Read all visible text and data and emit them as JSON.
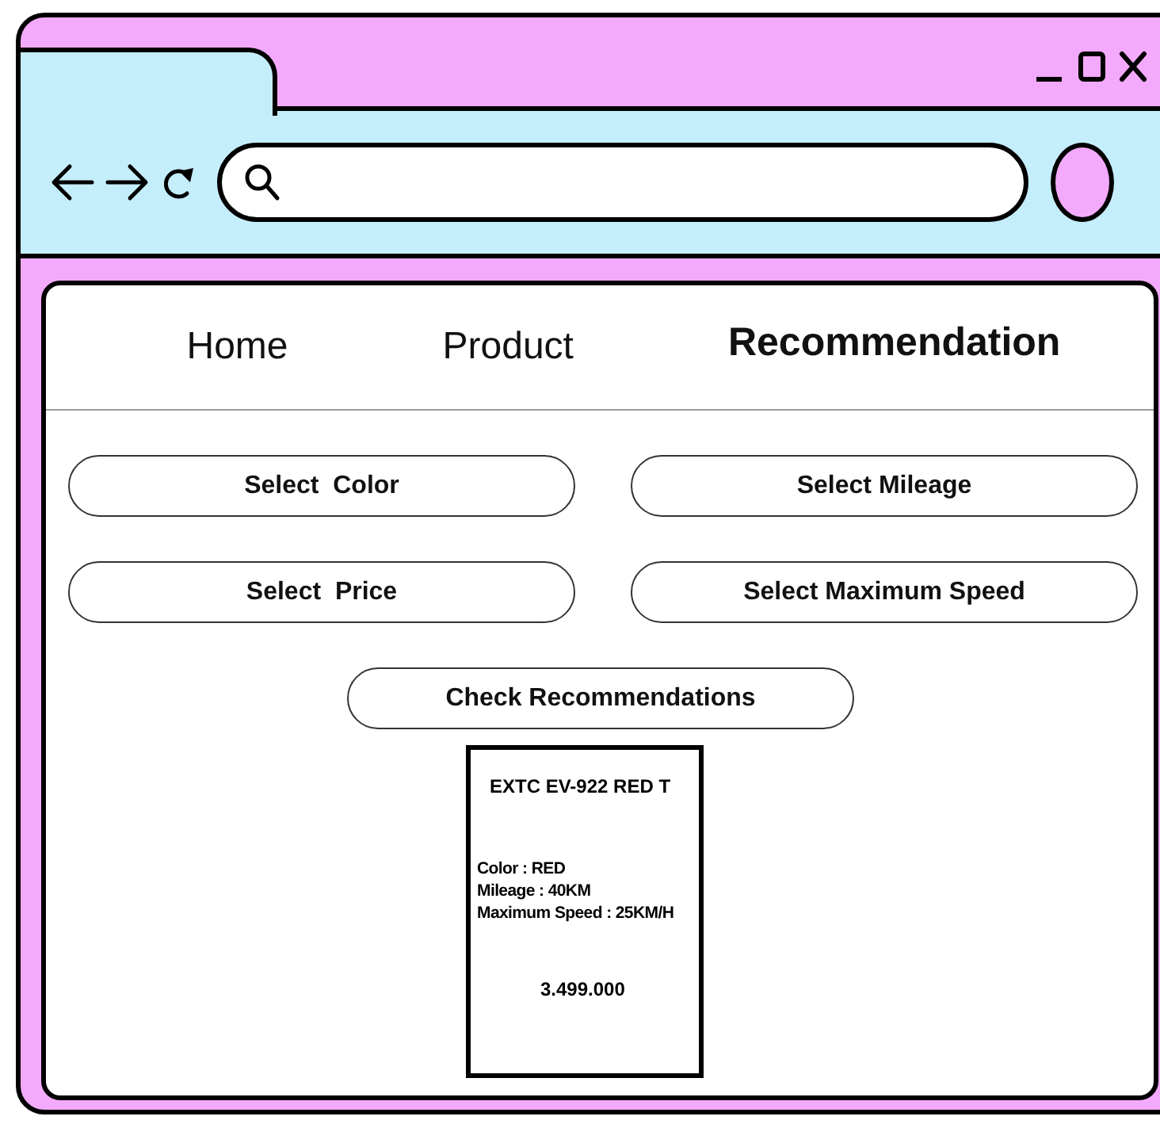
{
  "nav_tabs": [
    {
      "label": "Home",
      "selected": false
    },
    {
      "label": "Product",
      "selected": false
    },
    {
      "label": "Recommendation",
      "selected": true
    }
  ],
  "filters": [
    "Select  Color",
    "Select Mileage",
    "Select  Price",
    "Select Maximum Speed"
  ],
  "check_button": "Check Recommendations",
  "product": {
    "title": "EXTC EV-922 RED T",
    "specs": [
      "Color : RED",
      "Mileage : 40KM",
      "Maximum Speed : 25KM/H"
    ],
    "price": "3.499.000"
  }
}
